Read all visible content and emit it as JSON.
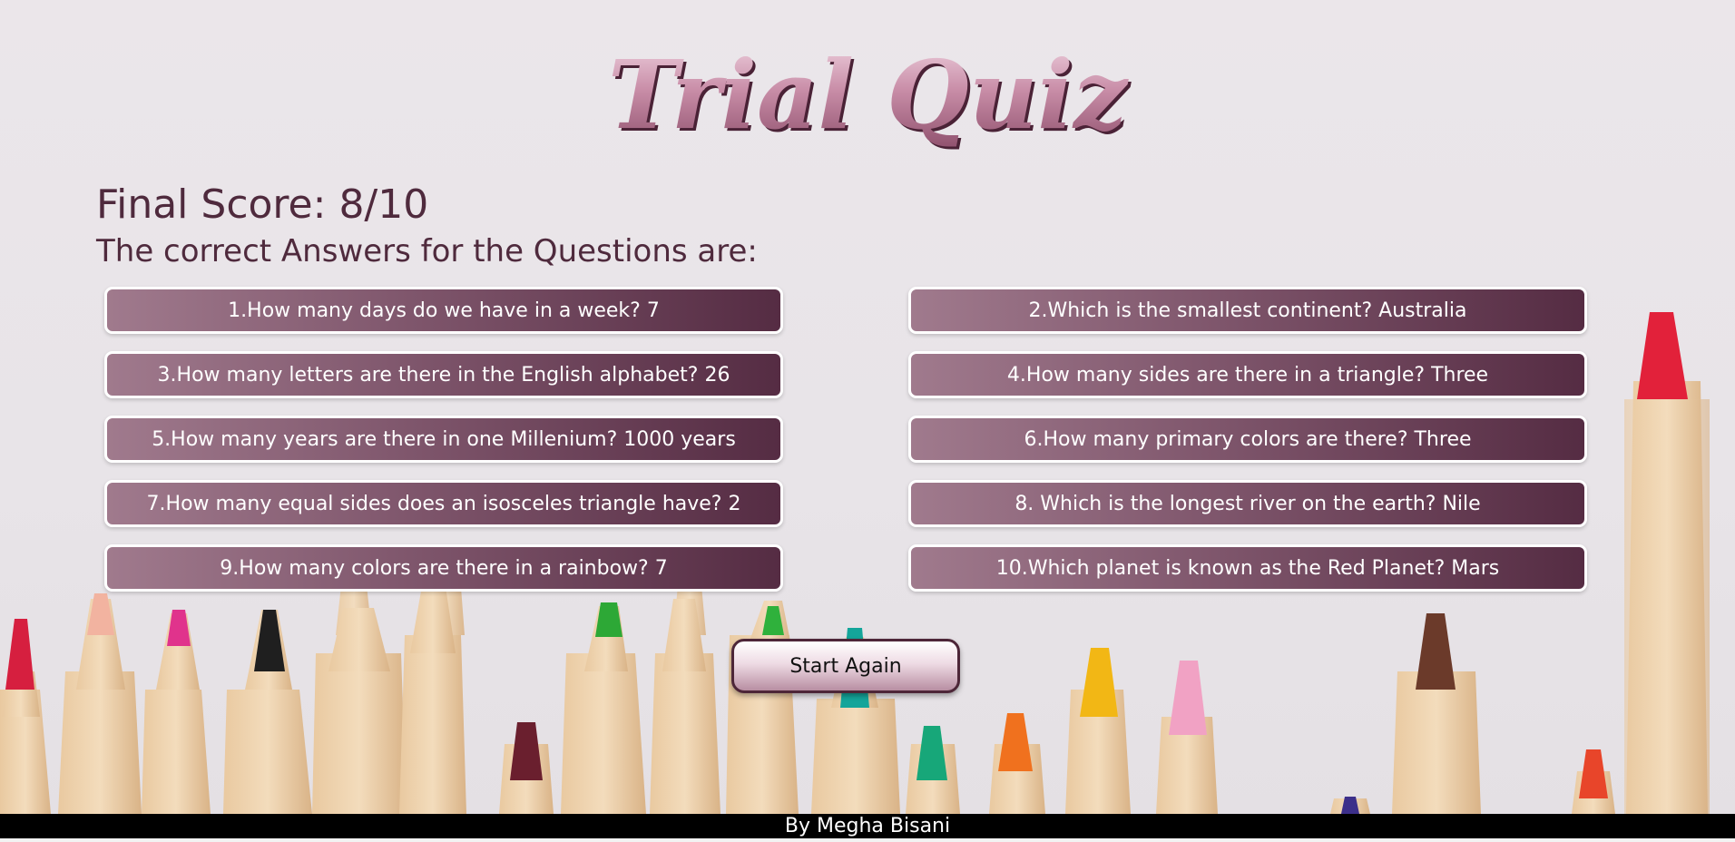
{
  "app": {
    "title": "Trial Quiz"
  },
  "results": {
    "score_text": "Final Score: 8/10",
    "subheading": "The correct Answers for the Questions are:",
    "answers": [
      "1.How many days do we have in a week? 7",
      "2.Which is the smallest continent? Australia",
      "3.How many letters are there in the English alphabet? 26",
      "4.How many sides are there in a triangle? Three",
      "5.How many years are there in one Millenium? 1000 years",
      "6.How many primary colors are there? Three",
      "7.How many equal sides does an isosceles triangle have? 2",
      "8. Which is the longest river on the earth? Nile",
      "9.How many colors are there in a rainbow? 7",
      "10.Which planet is known as the Red Planet? Mars"
    ]
  },
  "actions": {
    "start_again_label": "Start Again"
  },
  "footer": {
    "credit": "By Megha Bisani"
  },
  "colors": {
    "card_gradient_start": "#a07a8d",
    "card_gradient_end": "#552c43",
    "heading_text": "#4f2a3d",
    "footer_background": "#000000"
  },
  "background": {
    "icon": "colored-pencils-illustration"
  }
}
